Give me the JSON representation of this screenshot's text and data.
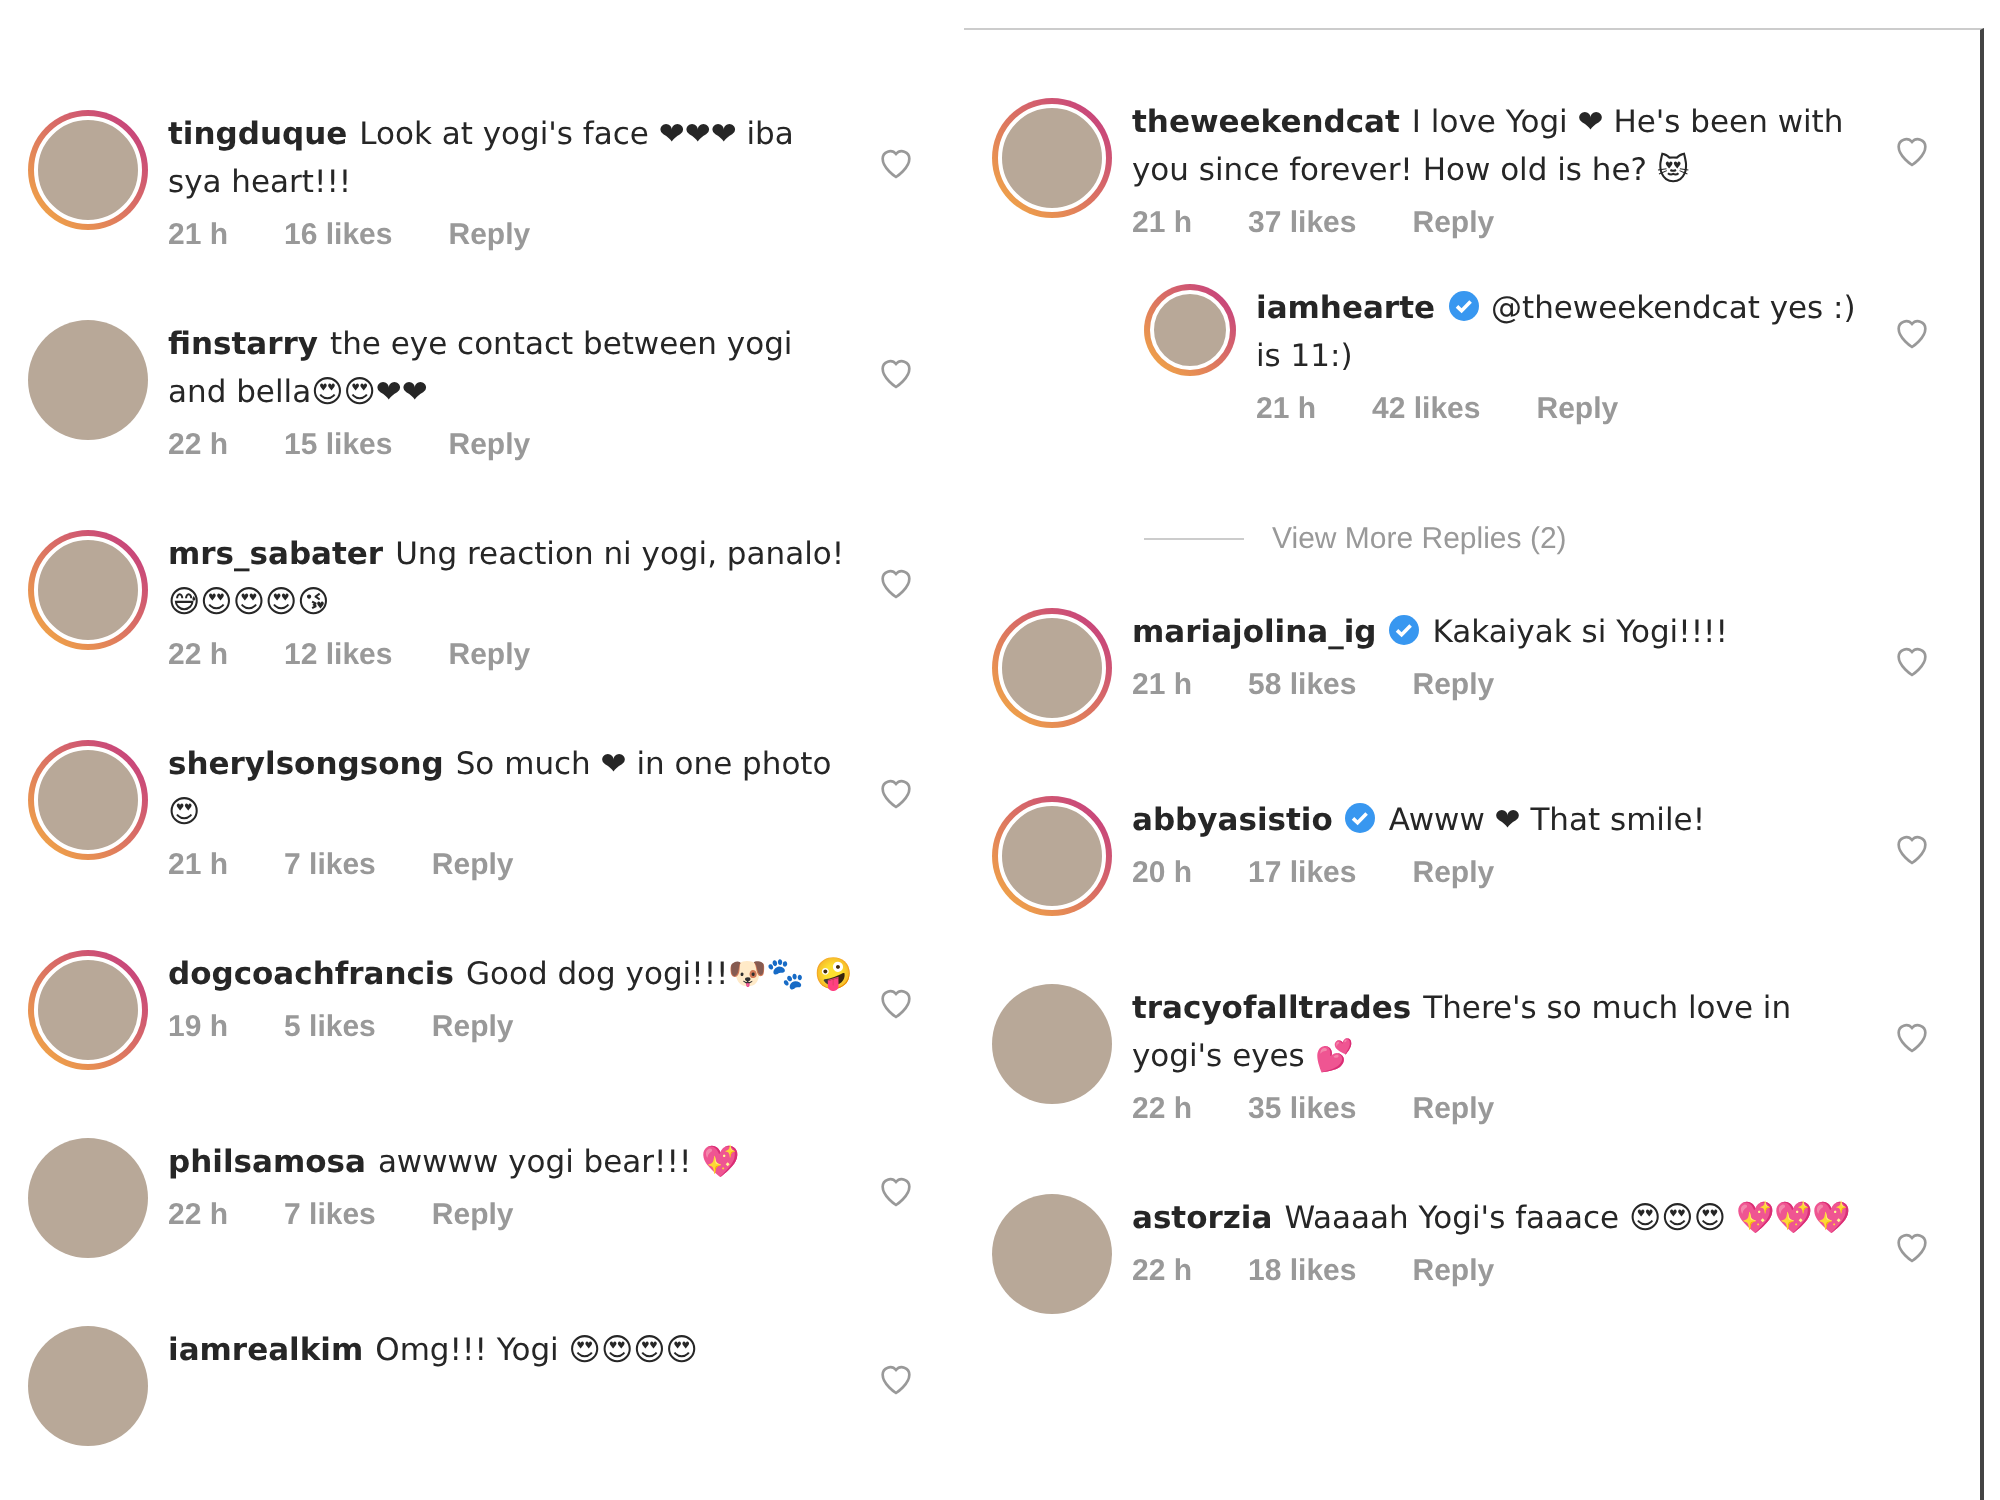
{
  "left": {
    "comments": [
      {
        "user": "tingduque",
        "verified": false,
        "story_ring": true,
        "text": "Look at yogi's face ❤❤❤ iba sya heart!!!",
        "time": "21 h",
        "likes": "16 likes",
        "reply": "Reply"
      },
      {
        "user": "finstarry",
        "verified": false,
        "story_ring": false,
        "text": "the eye contact between yogi and bella😍😍❤❤",
        "time": "22 h",
        "likes": "15 likes",
        "reply": "Reply"
      },
      {
        "user": "mrs_sabater",
        "verified": false,
        "story_ring": true,
        "text": "Ung reaction ni yogi, panalo!😅😍😍😍😘",
        "time": "22 h",
        "likes": "12 likes",
        "reply": "Reply"
      },
      {
        "user": "sherylsongsong",
        "verified": false,
        "story_ring": true,
        "text": "So much ❤ in one photo 😍",
        "time": "21 h",
        "likes": "7 likes",
        "reply": "Reply"
      },
      {
        "user": "dogcoachfrancis",
        "verified": false,
        "story_ring": true,
        "text": "Good dog yogi!!!🐶🐾 🤪",
        "time": "19 h",
        "likes": "5 likes",
        "reply": "Reply"
      },
      {
        "user": "philsamosa",
        "verified": false,
        "story_ring": false,
        "text": "awwww yogi bear!!! 💖",
        "time": "22 h",
        "likes": "7 likes",
        "reply": "Reply"
      },
      {
        "user": "iamrealkim",
        "verified": false,
        "story_ring": false,
        "text": "Omg!!! Yogi 😍😍😍😍"
      }
    ]
  },
  "right": {
    "comments": [
      {
        "user": "theweekendcat",
        "verified": false,
        "story_ring": true,
        "text": "I love Yogi ❤ He's been with you since forever! How old is he? 😻",
        "time": "21 h",
        "likes": "37 likes",
        "reply": "Reply",
        "replies": [
          {
            "user": "iamhearte",
            "verified": true,
            "story_ring": true,
            "text": "@theweekendcat yes :) is 11:)",
            "time": "21 h",
            "likes": "42 likes",
            "reply": "Reply"
          }
        ],
        "view_more": "View More Replies (2)"
      },
      {
        "user": "mariajolina_ig",
        "verified": true,
        "story_ring": true,
        "text": "Kakaiyak si Yogi!!!!",
        "time": "21 h",
        "likes": "58 likes",
        "reply": "Reply"
      },
      {
        "user": "abbyasistio",
        "verified": true,
        "story_ring": true,
        "text": "Awww ❤ That smile!",
        "time": "20 h",
        "likes": "17 likes",
        "reply": "Reply"
      },
      {
        "user": "tracyofalltrades",
        "verified": false,
        "story_ring": false,
        "text": "There's so much love in yogi's eyes 💕",
        "time": "22 h",
        "likes": "35 likes",
        "reply": "Reply"
      },
      {
        "user": "astorzia",
        "verified": false,
        "story_ring": false,
        "text": "Waaaah Yogi's faaace 😍😍😍 💖💖💖",
        "time": "22 h",
        "likes": "18 likes",
        "reply": "Reply"
      }
    ]
  }
}
